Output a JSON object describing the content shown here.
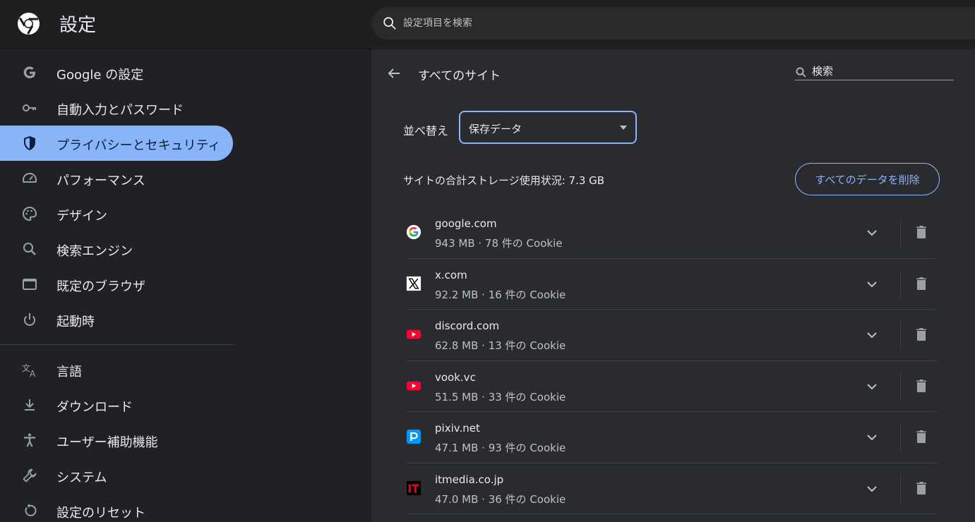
{
  "header": {
    "title": "設定",
    "search_placeholder": "設定項目を検索"
  },
  "sidebar": {
    "items": [
      {
        "label": "Google の設定",
        "icon": "google-g-icon"
      },
      {
        "label": "自動入力とパスワード",
        "icon": "key-icon"
      },
      {
        "label": "プライバシーとセキュリティ",
        "icon": "shield-icon",
        "active": true
      },
      {
        "label": "パフォーマンス",
        "icon": "speedometer-icon"
      },
      {
        "label": "デザイン",
        "icon": "palette-icon"
      },
      {
        "label": "検索エンジン",
        "icon": "search-icon"
      },
      {
        "label": "既定のブラウザ",
        "icon": "browser-window-icon"
      },
      {
        "label": "起動時",
        "icon": "power-icon"
      },
      {
        "label": "言語",
        "icon": "translate-icon"
      },
      {
        "label": "ダウンロード",
        "icon": "download-icon"
      },
      {
        "label": "ユーザー補助機能",
        "icon": "accessibility-icon"
      },
      {
        "label": "システム",
        "icon": "wrench-icon"
      },
      {
        "label": "設定のリセット",
        "icon": "reset-icon"
      }
    ]
  },
  "main": {
    "title": "すべてのサイト",
    "search_placeholder": "検索",
    "sort_label": "並べ替え",
    "sort_value": "保存データ",
    "storage_text": "サイトの合計ストレージ使用状況: 7.3 GB",
    "delete_all_label": "すべてのデータを削除",
    "sites": [
      {
        "name": "google.com",
        "detail": "943 MB · 78 件の Cookie",
        "favicon": "google-favicon"
      },
      {
        "name": "x.com",
        "detail": "92.2 MB · 16 件の Cookie",
        "favicon": "x-favicon"
      },
      {
        "name": "discord.com",
        "detail": "62.8 MB · 13 件の Cookie",
        "favicon": "youtube-favicon"
      },
      {
        "name": "vook.vc",
        "detail": "51.5 MB · 33 件の Cookie",
        "favicon": "youtube-favicon"
      },
      {
        "name": "pixiv.net",
        "detail": "47.1 MB · 93 件の Cookie",
        "favicon": "pixiv-favicon"
      },
      {
        "name": "itmedia.co.jp",
        "detail": "47.0 MB · 36 件の Cookie",
        "favicon": "itmedia-favicon"
      }
    ]
  },
  "colors": {
    "accent": "#8ab4f8",
    "background": "#202124",
    "panel": "#2a2b2f",
    "text": "#e8eaed"
  }
}
